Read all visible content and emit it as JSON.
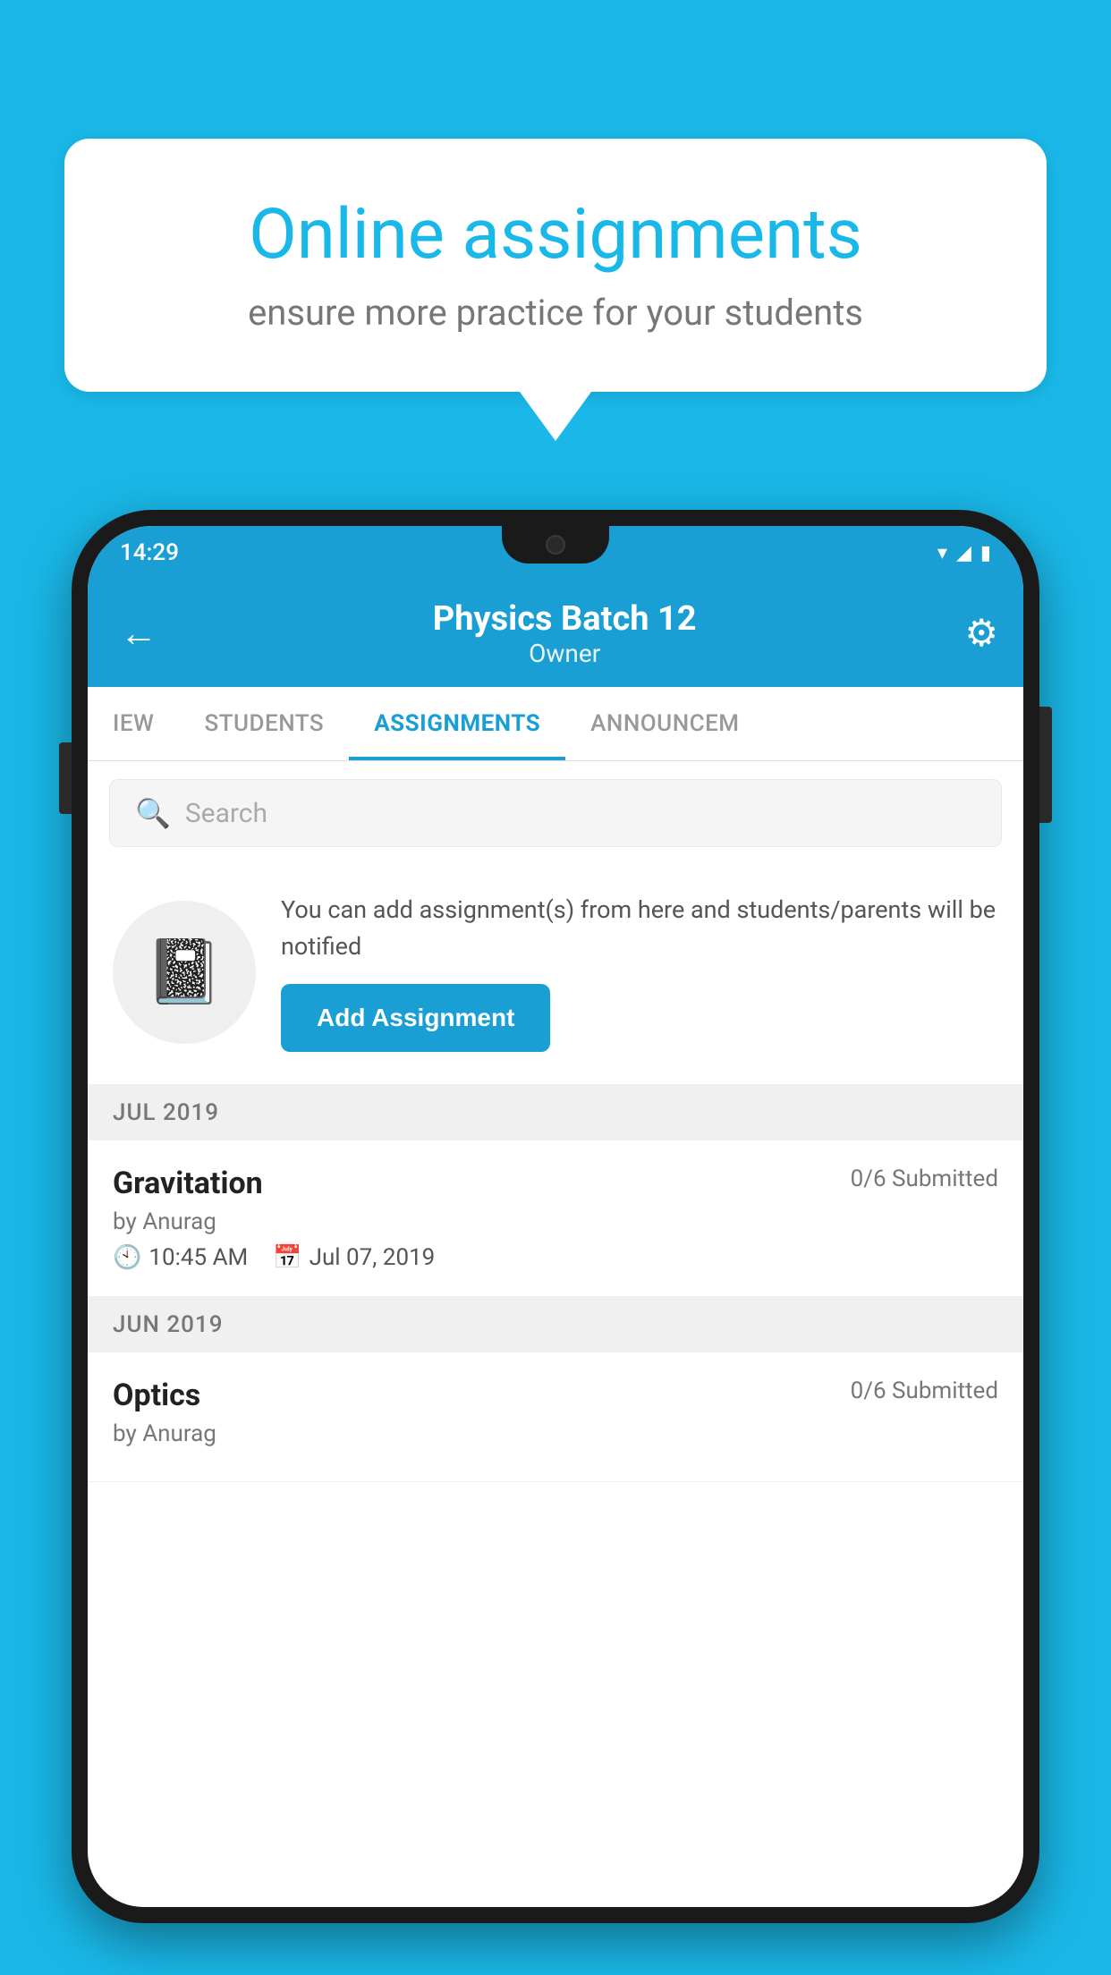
{
  "background": {
    "color": "#1ab8e8"
  },
  "speech_bubble": {
    "title": "Online assignments",
    "subtitle": "ensure more practice for your students"
  },
  "status_bar": {
    "time": "14:29",
    "wifi": "▾",
    "signal": "▲",
    "battery": "▮"
  },
  "app_bar": {
    "title": "Physics Batch 12",
    "subtitle": "Owner",
    "back_label": "←",
    "settings_label": "⚙"
  },
  "tabs": [
    {
      "label": "IEW",
      "active": false
    },
    {
      "label": "STUDENTS",
      "active": false
    },
    {
      "label": "ASSIGNMENTS",
      "active": true
    },
    {
      "label": "ANNOUNCEM",
      "active": false
    }
  ],
  "search": {
    "placeholder": "Search"
  },
  "promo": {
    "text": "You can add assignment(s) from here and students/parents will be notified",
    "button_label": "Add Assignment"
  },
  "sections": [
    {
      "header": "JUL 2019",
      "assignments": [
        {
          "title": "Gravitation",
          "submitted": "0/6 Submitted",
          "author": "by Anurag",
          "time": "10:45 AM",
          "date": "Jul 07, 2019"
        }
      ]
    },
    {
      "header": "JUN 2019",
      "assignments": [
        {
          "title": "Optics",
          "submitted": "0/6 Submitted",
          "author": "by Anurag",
          "time": "",
          "date": ""
        }
      ]
    }
  ]
}
